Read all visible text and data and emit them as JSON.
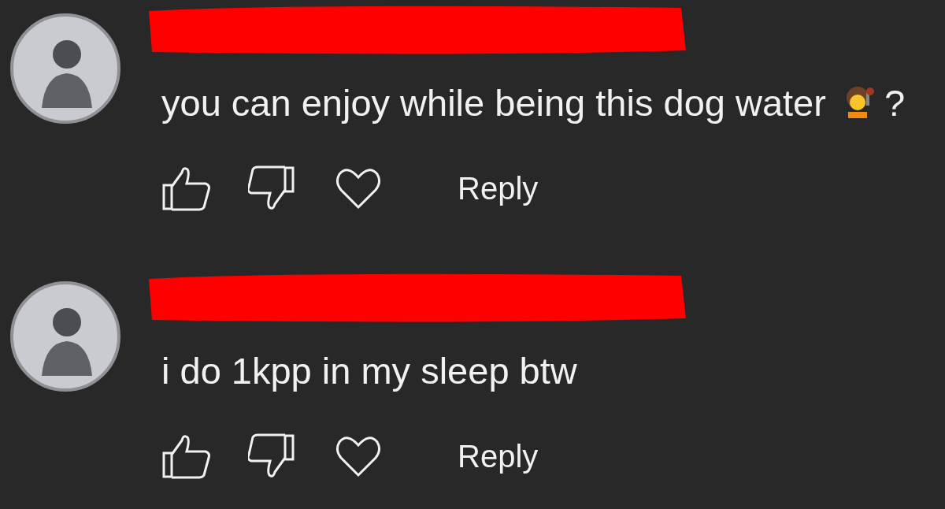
{
  "comments": [
    {
      "author": {
        "redacted": true
      },
      "text": "you can enjoy while being this dog water",
      "has_emoji": true,
      "trailing": "?",
      "actions": {
        "reply": "Reply"
      }
    },
    {
      "author": {
        "redacted": true
      },
      "text": "i do 1kpp in my sleep btw",
      "actions": {
        "reply": "Reply"
      }
    }
  ]
}
